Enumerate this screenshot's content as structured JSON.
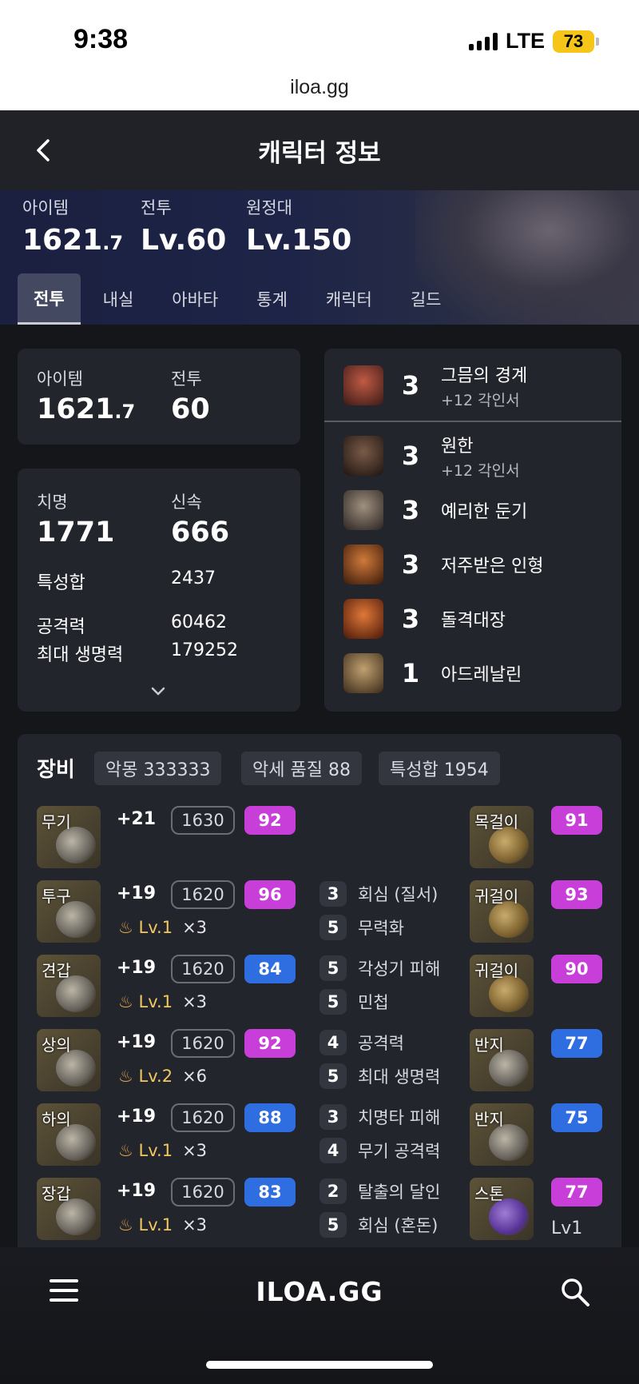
{
  "status": {
    "time": "9:38",
    "network": "LTE",
    "battery": "73"
  },
  "url": "iloa.gg",
  "header": {
    "title": "캐릭터 정보"
  },
  "hero": {
    "stats": [
      {
        "label": "아이템",
        "value": "1621",
        "decimal": ".7"
      },
      {
        "label": "전투",
        "value": "Lv.60"
      },
      {
        "label": "원정대",
        "value": "Lv.150"
      }
    ],
    "tabs": [
      "전투",
      "내실",
      "아바타",
      "통계",
      "캐릭터",
      "길드"
    ],
    "active_tab": "전투"
  },
  "summary": {
    "item_label": "아이템",
    "item_value": "1621",
    "item_decimal": ".7",
    "combat_label": "전투",
    "combat_value": "60"
  },
  "stats": {
    "crit_label": "치명",
    "crit_value": "1771",
    "swift_label": "신속",
    "swift_value": "666",
    "total_label": "특성합",
    "total_value": "2437",
    "atk_label": "공격력",
    "atk_value": "60462",
    "hp_label": "최대 생명력",
    "hp_value": "179252"
  },
  "engravings": [
    {
      "count": "3",
      "name": "그믐의 경계",
      "sub": "+12 각인서",
      "color": "#8a3a2e"
    },
    {
      "count": "3",
      "name": "원한",
      "sub": "+12 각인서",
      "color": "#4a2a1e"
    },
    {
      "count": "3",
      "name": "예리한 둔기",
      "sub": "",
      "color": "#5a4a40"
    },
    {
      "count": "3",
      "name": "저주받은 인형",
      "sub": "",
      "color": "#9a4a20"
    },
    {
      "count": "3",
      "name": "돌격대장",
      "sub": "",
      "color": "#a0401e"
    },
    {
      "count": "1",
      "name": "아드레날린",
      "sub": "",
      "color": "#7a6040"
    }
  ],
  "equipment": {
    "title": "장비",
    "chips": [
      "악몽 333333",
      "악세 품질 88",
      "특성합 1954"
    ],
    "gear": [
      {
        "slot": "무기",
        "plus": "+21",
        "ilvl": "1630",
        "quality": "92",
        "qcolor": "purple",
        "lv": "",
        "mult": ""
      },
      {
        "slot": "투구",
        "plus": "+19",
        "ilvl": "1620",
        "quality": "96",
        "qcolor": "purple",
        "lv": "Lv.1",
        "mult": "×3"
      },
      {
        "slot": "견갑",
        "plus": "+19",
        "ilvl": "1620",
        "quality": "84",
        "qcolor": "blue",
        "lv": "Lv.1",
        "mult": "×3"
      },
      {
        "slot": "상의",
        "plus": "+19",
        "ilvl": "1620",
        "quality": "92",
        "qcolor": "purple",
        "lv": "Lv.2",
        "mult": "×6"
      },
      {
        "slot": "하의",
        "plus": "+19",
        "ilvl": "1620",
        "quality": "88",
        "qcolor": "blue",
        "lv": "Lv.1",
        "mult": "×3"
      },
      {
        "slot": "장갑",
        "plus": "+19",
        "ilvl": "1620",
        "quality": "83",
        "qcolor": "blue",
        "lv": "Lv.1",
        "mult": "×3"
      }
    ],
    "effects": [
      {
        "n": "3",
        "name": "회심 (질서)"
      },
      {
        "n": "5",
        "name": "무력화"
      },
      {
        "n": "5",
        "name": "각성기 피해"
      },
      {
        "n": "5",
        "name": "민첩"
      },
      {
        "n": "4",
        "name": "공격력"
      },
      {
        "n": "5",
        "name": "최대 생명력"
      },
      {
        "n": "3",
        "name": "치명타 피해"
      },
      {
        "n": "4",
        "name": "무기 공격력"
      },
      {
        "n": "2",
        "name": "탈출의 달인"
      },
      {
        "n": "5",
        "name": "회심 (혼돈)"
      }
    ],
    "accessories": [
      {
        "slot": "목걸이",
        "quality": "91",
        "qcolor": "purple"
      },
      {
        "slot": "귀걸이",
        "quality": "93",
        "qcolor": "purple"
      },
      {
        "slot": "귀걸이",
        "quality": "90",
        "qcolor": "purple"
      },
      {
        "slot": "반지",
        "quality": "77",
        "qcolor": "blue"
      },
      {
        "slot": "반지",
        "quality": "75",
        "qcolor": "blue"
      },
      {
        "slot": "스톤",
        "quality": "77",
        "qcolor": "purple",
        "level": "Lv1"
      }
    ]
  },
  "bottom": {
    "logo": "ILOA.GG"
  }
}
